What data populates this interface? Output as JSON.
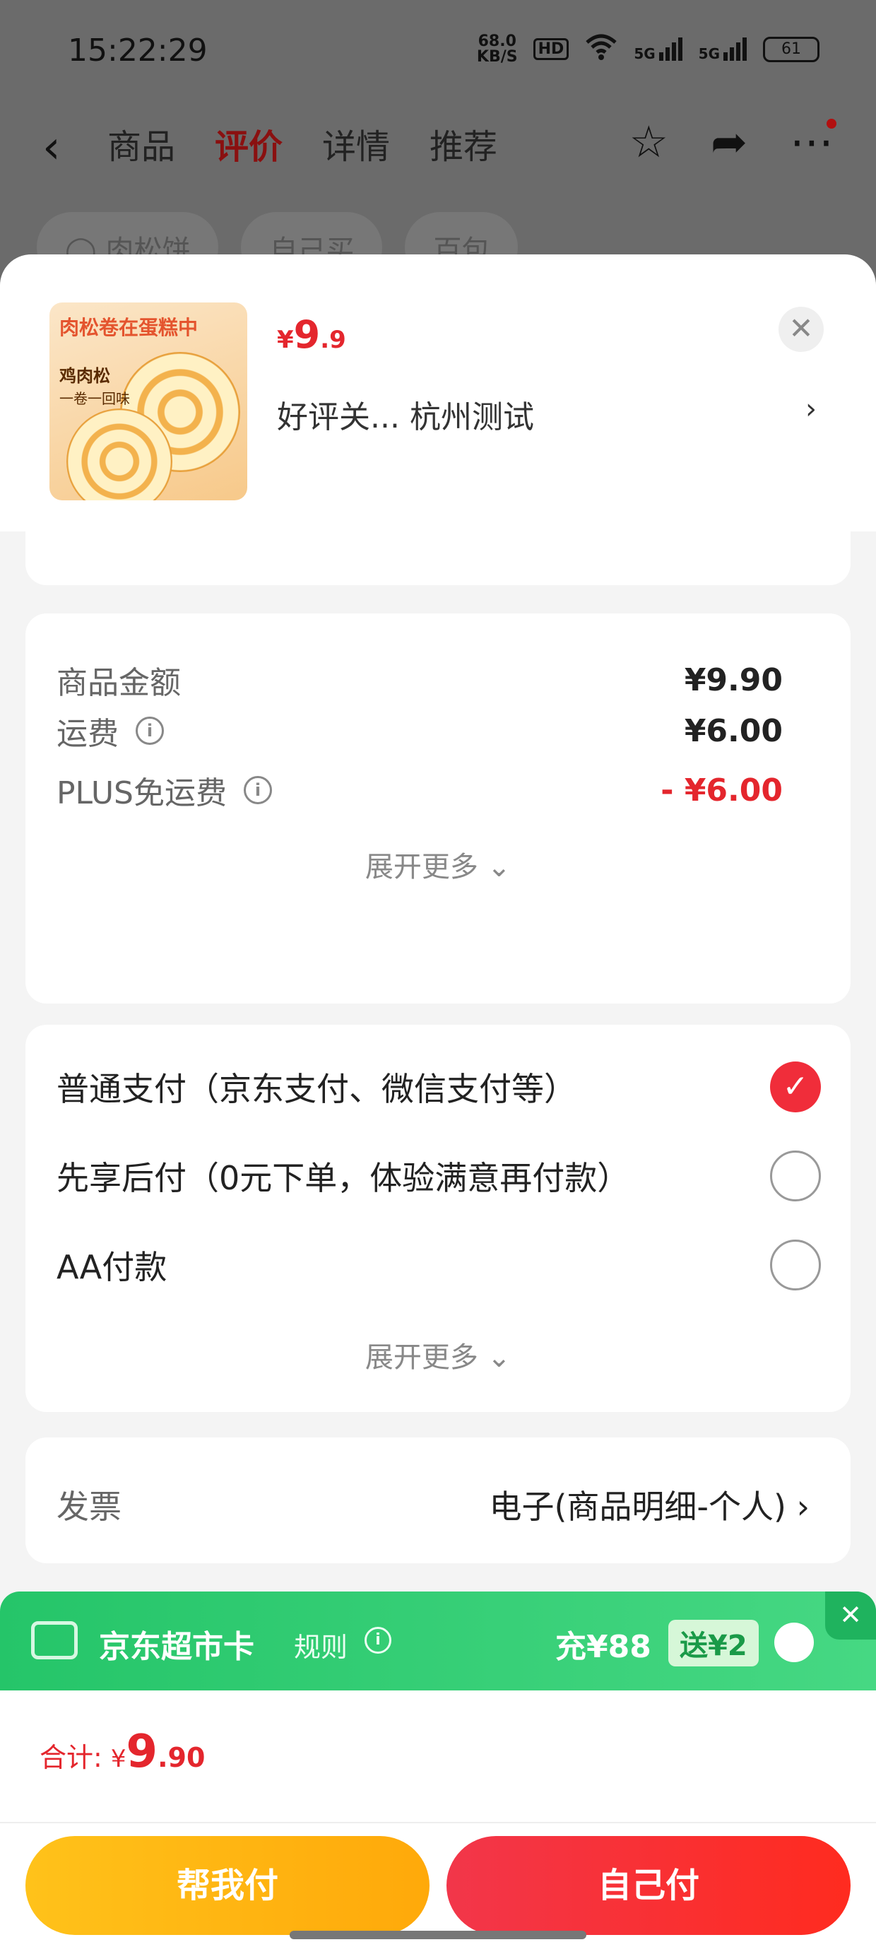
{
  "status_bar": {
    "time": "15:22:29",
    "net_speed_value": "68.0",
    "net_speed_unit": "KB/S",
    "hd_badge": "HD",
    "signal1": "5G",
    "signal2": "5G",
    "battery": "61"
  },
  "nav": {
    "tabs": [
      {
        "label": "商品",
        "active": false
      },
      {
        "label": "评价",
        "active": true
      },
      {
        "label": "详情",
        "active": false
      },
      {
        "label": "推荐",
        "active": false
      }
    ]
  },
  "filters": [
    "肉松饼",
    "自己买",
    "百包"
  ],
  "product": {
    "thumb_title": "肉松卷在蛋糕中",
    "thumb_sub1": "鸡肉松",
    "thumb_sub2": "一卷一回味",
    "price_symbol": "¥",
    "price_int": "9",
    "price_dec": ".9",
    "desc": "好评关...  杭州测试"
  },
  "cost": {
    "rows": [
      {
        "label": "商品金额",
        "value": "¥9.90",
        "info": false
      },
      {
        "label": "运费",
        "value": "¥6.00",
        "info": true
      },
      {
        "label": "PLUS免运费",
        "value": "- ¥6.00",
        "info": true
      }
    ],
    "expand_label": "展开更多"
  },
  "payment": {
    "options": [
      {
        "label": "普通支付（京东支付、微信支付等）",
        "selected": true
      },
      {
        "label": "先享后付（0元下单，体验满意再付款）",
        "selected": false
      },
      {
        "label": "AA付款",
        "selected": false
      }
    ],
    "expand_label": "展开更多"
  },
  "invoice": {
    "label": "发票",
    "value": "电子(商品明细-个人)"
  },
  "promo": {
    "title": "京东超市卡",
    "rule": "规则",
    "charge": "充¥88",
    "bonus": "送¥2"
  },
  "footer": {
    "total_label": "合计: ",
    "total_symbol": "¥",
    "total_int": "9",
    "total_dec": ".90",
    "help_pay_label": "帮我付",
    "self_pay_label": "自己付"
  },
  "colors": {
    "accent_red": "#e4262d",
    "promo_green": "#25c569",
    "help_btn_yellow": "#ffb814"
  }
}
